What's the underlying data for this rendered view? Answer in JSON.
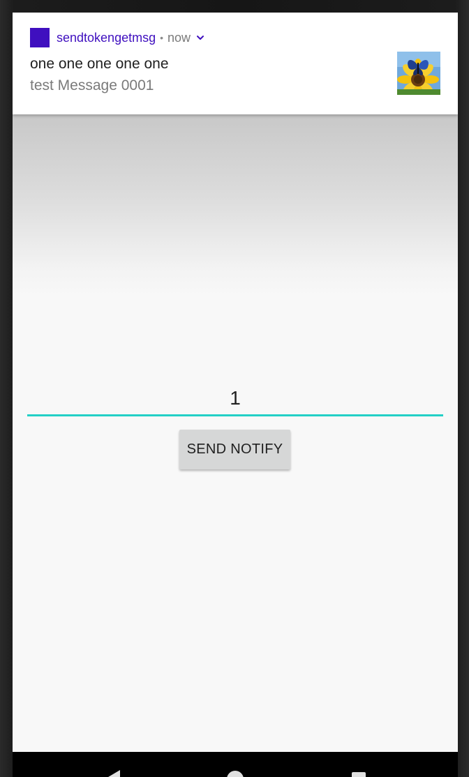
{
  "notification": {
    "app_name": "sendtokengetmsg",
    "separator": "•",
    "time": "now",
    "title": "one one one one one",
    "text": "test Message 0001",
    "accent_color": "#3f0fbf",
    "thumbnail": "sunflower-butterfly-image"
  },
  "main": {
    "input_value": "1",
    "input_underline_color": "#23d0c6",
    "send_button_label": "SEND NOTIFY"
  },
  "navbar": {
    "buttons": [
      "back-icon",
      "home-icon",
      "recents-icon"
    ]
  }
}
